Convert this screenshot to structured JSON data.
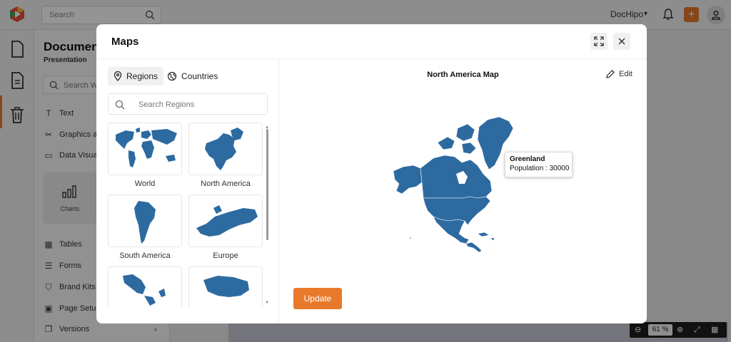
{
  "app": {
    "search_placeholder": "Search",
    "brand": "DocHipo",
    "document_title": "Documen",
    "document_subtitle": "Presentation",
    "panel_search_placeholder": "Search Wi",
    "menu": [
      {
        "label": "Text",
        "icon": "text-icon"
      },
      {
        "label": "Graphics an",
        "icon": "graphics-icon"
      },
      {
        "label": "Data Visual",
        "icon": "data-visual-icon"
      },
      {
        "label": "Tables",
        "icon": "table-icon"
      },
      {
        "label": "Forms",
        "icon": "forms-icon"
      },
      {
        "label": "Brand Kits",
        "icon": "brand-kit-icon"
      },
      {
        "label": "Page Setup",
        "icon": "page-setup-icon"
      },
      {
        "label": "Versions",
        "icon": "versions-icon"
      }
    ],
    "charts_tile_label": "Charts",
    "zoom": "61 %",
    "accent_color": "#e8792b"
  },
  "modal": {
    "title": "Maps",
    "tabs": [
      {
        "label": "Regions",
        "icon": "pin-icon",
        "active": true
      },
      {
        "label": "Countries",
        "icon": "globe-icon",
        "active": false
      }
    ],
    "search_placeholder": "Search Regions",
    "maps": [
      {
        "label": "World"
      },
      {
        "label": "North America"
      },
      {
        "label": "South America"
      },
      {
        "label": "Europe"
      },
      {
        "label": ""
      },
      {
        "label": ""
      }
    ],
    "preview_title": "North America Map",
    "edit_label": "Edit",
    "tooltip": {
      "name": "Greenland",
      "value": "Population : 30000"
    },
    "update_label": "Update",
    "map_color": "#2d6aa0"
  }
}
